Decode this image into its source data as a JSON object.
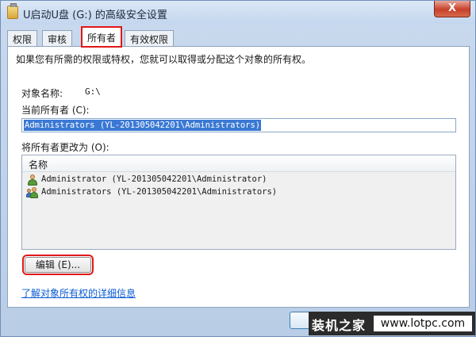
{
  "window": {
    "title": "U启动U盘 (G:) 的高级安全设置",
    "close_label": "X"
  },
  "tabs": [
    {
      "label": "权限"
    },
    {
      "label": "审核"
    },
    {
      "label": "所有者",
      "active": true
    },
    {
      "label": "有效权限"
    }
  ],
  "owner_tab": {
    "intro": "如果您有所需的权限或特权，您就可以取得或分配这个对象的所有权。",
    "object_name_label": "对象名称:",
    "object_name_value": "G:\\",
    "current_owner_label": "当前所有者 (C):",
    "current_owner_value": "Administrators (YL-201305042201\\Administrators)",
    "change_owner_label": "将所有者更改为 (O):",
    "list_header_name": "名称",
    "owner_candidates": [
      {
        "name": "Administrator (YL-201305042201\\Administrator)",
        "icon": "user-icon"
      },
      {
        "name": "Administrators (YL-201305042201\\Administrators)",
        "icon": "group-icon"
      }
    ],
    "edit_button": "编辑 (E)...",
    "learn_more_link": "了解对象所有权的详细信息"
  },
  "watermark": {
    "left_text": "装机之家",
    "right_text": "www.lotpc.com"
  },
  "colors": {
    "highlight_outline": "#e01818",
    "selection": "#3a78d4",
    "link": "#0b5bd3"
  }
}
